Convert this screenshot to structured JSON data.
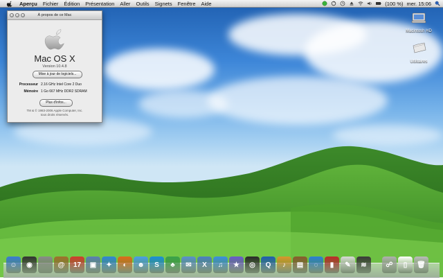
{
  "menubar": {
    "app_name": "Aperçu",
    "items": [
      "Fichier",
      "Édition",
      "Présentation",
      "Aller",
      "Outils",
      "Signets",
      "Fenêtre",
      "Aide"
    ],
    "battery": "(100 %)",
    "clock": "mer. 15:06"
  },
  "about_window": {
    "title": "À propos de ce Mac",
    "os_name": "Mac OS X",
    "os_version": "Version 10.4.8",
    "update_button": "Mise à jour de logiciels...",
    "processor_label": "Processeur",
    "processor_value": "2.16 GHz Intel Core 2 Duo",
    "memory_label": "Mémoire",
    "memory_value": "1 Go 667 MHz  DDR2 SDRAM",
    "more_info_button": "Plus d'infos...",
    "copyright_line1": "TM & © 1983-2006 Apple Computer, Inc.",
    "copyright_line2": "tous droits réservés."
  },
  "desktop_icons": [
    {
      "label": "Macintosh HD",
      "icon": "hard-drive-icon"
    },
    {
      "label": "Utilitaires",
      "icon": "folder-icon"
    }
  ],
  "dock": {
    "items": [
      {
        "name": "finder",
        "color": "#3a7bd5",
        "glyph": "☺"
      },
      {
        "name": "dashboard",
        "color": "#333333",
        "glyph": "◉"
      },
      {
        "name": "system-preferences",
        "color": "#8a8a8a",
        "glyph": ""
      },
      {
        "name": "address-book",
        "color": "#a0702c",
        "glyph": "@"
      },
      {
        "name": "ical",
        "color": "#d33b2e",
        "glyph": "17"
      },
      {
        "name": "preview",
        "color": "#5b7fb5",
        "glyph": "▣"
      },
      {
        "name": "safari",
        "color": "#2f86d8",
        "glyph": "✦"
      },
      {
        "name": "firefox",
        "color": "#e06a1a",
        "glyph": "◐"
      },
      {
        "name": "ichat",
        "color": "#4a9ee8",
        "glyph": "☻"
      },
      {
        "name": "skype",
        "color": "#1a8fd9",
        "glyph": "S"
      },
      {
        "name": "adium",
        "color": "#3aa34a",
        "glyph": "♣"
      },
      {
        "name": "mail",
        "color": "#5a8fcf",
        "glyph": "✉"
      },
      {
        "name": "xcode",
        "color": "#4d7fc4",
        "glyph": "X"
      },
      {
        "name": "itunes",
        "color": "#3b8fe0",
        "glyph": "♫"
      },
      {
        "name": "imovie",
        "color": "#6a5acd",
        "glyph": "★"
      },
      {
        "name": "dvd-player",
        "color": "#2a2a2a",
        "glyph": "◎"
      },
      {
        "name": "quicktime",
        "color": "#1f5fb3",
        "glyph": "Q"
      },
      {
        "name": "garageband",
        "color": "#d9962c",
        "glyph": "♪"
      },
      {
        "name": "iphoto",
        "color": "#8a5c2e",
        "glyph": "▤"
      },
      {
        "name": "internet-connect",
        "color": "#2b7fd5",
        "glyph": "◌"
      },
      {
        "name": "photo-booth",
        "color": "#c02a2a",
        "glyph": "▮"
      },
      {
        "name": "text-edit",
        "color": "#d8d8d8",
        "glyph": "✎"
      },
      {
        "name": "activity-monitor",
        "color": "#3a3a3a",
        "glyph": "≋"
      },
      {
        "name": "network-utility",
        "color": "#b0b0b0",
        "glyph": "☍"
      },
      {
        "name": "documents",
        "color": "#ffffff",
        "glyph": "▯"
      },
      {
        "name": "trash",
        "color": "#bbbbbb",
        "glyph": "🗑"
      }
    ]
  }
}
